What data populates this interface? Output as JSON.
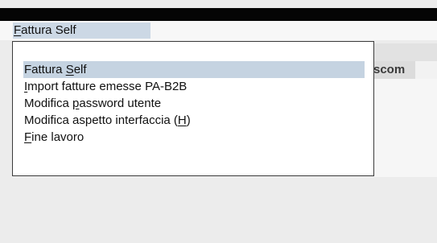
{
  "menubar": {
    "active_menu": {
      "mnemonic": "F",
      "rest": "attura Self"
    }
  },
  "background": {
    "partial_tab_label": "scom"
  },
  "dropdown": {
    "selected_index": 0,
    "items": [
      {
        "before": "Fattura ",
        "mnemonic": "S",
        "after": "elf"
      },
      {
        "before": "",
        "mnemonic": "I",
        "after": "mport fatture emesse PA-B2B"
      },
      {
        "before": "Modifica ",
        "mnemonic": "p",
        "after": "assword utente"
      },
      {
        "before": "Modifica aspetto interfaccia (",
        "mnemonic": "H",
        "after": ")"
      },
      {
        "before": "",
        "mnemonic": "F",
        "after": "ine lavoro"
      }
    ]
  },
  "colors": {
    "selection_bg": "#c5d3e1",
    "menubar_active_bg": "#ccd8e5",
    "title_strip": "#050505"
  }
}
